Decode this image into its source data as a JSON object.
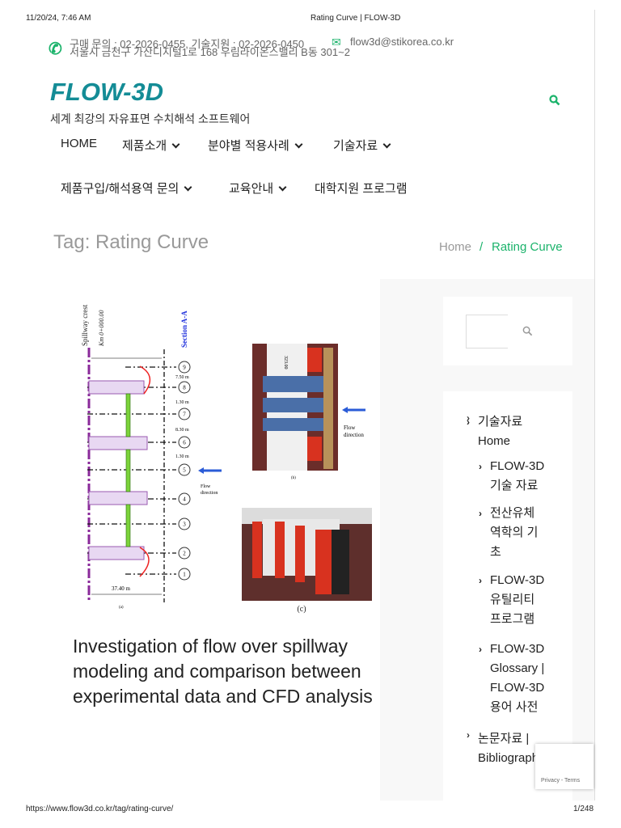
{
  "pdf_header": {
    "datetime": "11/20/24, 7:46 AM",
    "title": "Rating Curve | FLOW-3D"
  },
  "pdf_footer": {
    "url": "https://www.flow3d.co.kr/tag/rating-curve/",
    "page": "1/248"
  },
  "topbar": {
    "phone": "구매 문의 : 02-2026-0455, 기술지원 : 02-2026-0450",
    "email": "flow3d@stikorea.co.kr",
    "address": "서울시 금천구 가산디지털1로 168 우림라이온스밸리 B동 301~2"
  },
  "site": {
    "logo": "FLOW-3D",
    "tagline": "세계 최강의 자유표면 수치해석 소프트웨어"
  },
  "nav": [
    {
      "label": "HOME"
    },
    {
      "label": "제품소개"
    },
    {
      "label": "분야별 적용사례"
    },
    {
      "label": "기술자료"
    },
    {
      "label": "제품구입/해석용역 문의"
    },
    {
      "label": "교육안내"
    },
    {
      "label": "대학지원 프로그램"
    }
  ],
  "page": {
    "title": "Tag: Rating Curve",
    "breadcrumb": {
      "home": "Home",
      "sep": "/",
      "current": "Rating Curve"
    }
  },
  "figure": {
    "spillway": "Spillway crest",
    "km": "Km 0+000.00",
    "section": "Section A-A",
    "sections": [
      "9",
      "8",
      "7",
      "6",
      "5",
      "4",
      "3",
      "2",
      "1"
    ],
    "dims": [
      "7.50 m",
      "1.30 m",
      "8.30 m",
      "1.30 m"
    ],
    "width": "37.40 m",
    "flow": [
      "Flow",
      "direction"
    ],
    "panels": [
      "(a)",
      "(b)",
      "(c)"
    ],
    "elev": "323.00"
  },
  "article": {
    "title": "Investigation of flow over spillway modeling and comparison between experimental data and CFD analysis"
  },
  "sidebar": {
    "search_placeholder": "",
    "items": [
      {
        "label": "기술자료 Home",
        "level": 0
      },
      {
        "label": "FLOW-3D 기술 자료",
        "level": 1
      },
      {
        "label": "전산유체 역학의 기초",
        "level": 1
      },
      {
        "label": "FLOW-3D 유틸리티 프로그램",
        "level": 1
      },
      {
        "label": "FLOW-3D Glossary | FLOW-3D 용어 사전",
        "level": 1
      },
      {
        "label": "논문자료 | Bibliography",
        "level": 0
      }
    ]
  },
  "recaptcha": {
    "text": "Privacy - Terms"
  },
  "colors": {
    "accent": "#1bb36b",
    "logo": "#148c96"
  }
}
